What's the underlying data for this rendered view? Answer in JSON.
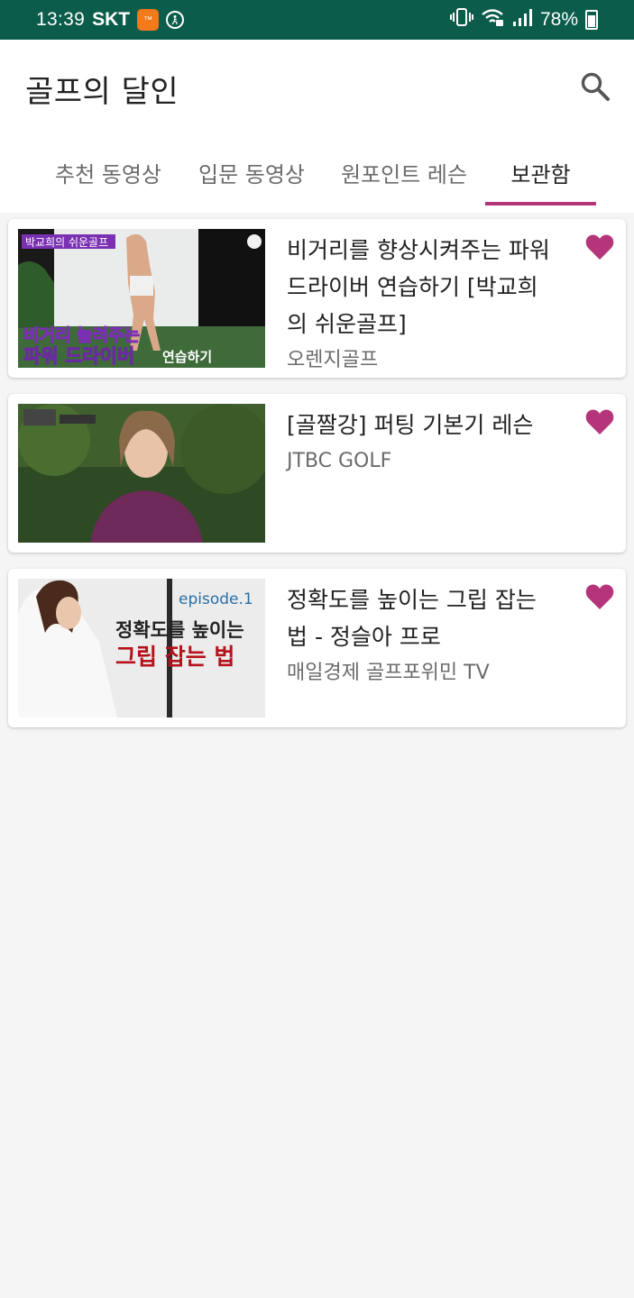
{
  "status_bar": {
    "time": "13:39",
    "carrier": "SKT",
    "battery": "78%",
    "app_badge_text": "™"
  },
  "app": {
    "title": "골프의 달인",
    "accent_color": "#b5357b",
    "status_bar_color": "#0b5c4a",
    "search_icon": "search-icon"
  },
  "tabs": [
    {
      "label": "추천 동영상",
      "active": false
    },
    {
      "label": "입문 동영상",
      "active": false
    },
    {
      "label": "원포인트 레슨",
      "active": false
    },
    {
      "label": "보관함",
      "active": true
    }
  ],
  "videos": [
    {
      "title": "비거리를 향상시켜주는 파워 드라이버 연습하기 [박교희의 쉬운골프]",
      "channel": "오렌지골프",
      "favorited": true,
      "thumb_text_top": "박교희의 쉬운골프",
      "thumb_text_line1": "비거리 늘려주는",
      "thumb_text_line2": "파워 드라이버",
      "thumb_text_line3": "연습하기"
    },
    {
      "title": "[골짤강] 퍼팅 기본기 레슨",
      "channel": "JTBC GOLF",
      "favorited": true
    },
    {
      "title": "정확도를 높이는 그립 잡는 법 - 정슬아 프로",
      "channel": "매일경제 골프포위민 TV",
      "favorited": true,
      "thumb_episode": "episode.1",
      "thumb_text_line1": "정확도를 높이는",
      "thumb_text_line2": "그립 잡는 법"
    }
  ]
}
